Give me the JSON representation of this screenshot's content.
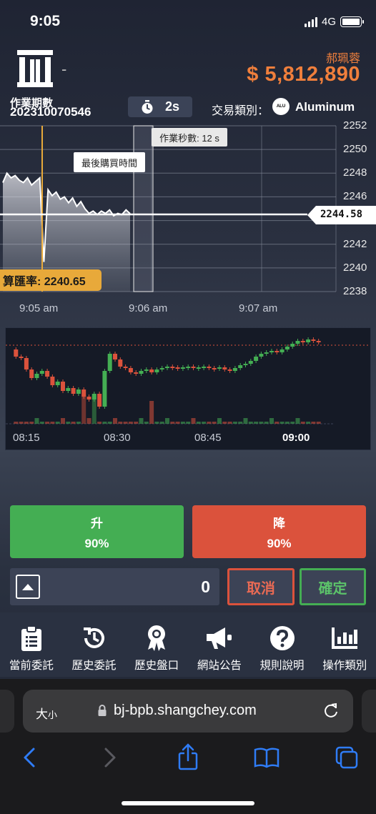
{
  "status_bar": {
    "time": "9:05",
    "network": "4G"
  },
  "header": {
    "logo_suffix": "-",
    "user_name": "郝珮蓉",
    "balance": "$ 5,812,890"
  },
  "info_bar": {
    "period_label": "作業期數",
    "period_value": "202310070546",
    "timer": "2s",
    "trade_type_label": "交易類別：",
    "trade_type_badge": "ALU",
    "trade_type_value": "Aluminum"
  },
  "main_chart": {
    "y_ticks": [
      "2252",
      "2250",
      "2248",
      "2246",
      "2244",
      "2242",
      "2240",
      "2238"
    ],
    "x_ticks": [
      "9:05 am",
      "9:06 am",
      "9:07 am"
    ],
    "tooltip_period": "作業秒數: 12 s",
    "tooltip_last_buy": "最後購買時間",
    "current_price": "2244.58",
    "rate_label": "算匯率: 2240.65"
  },
  "candle_chart": {
    "x_ticks": [
      "08:15",
      "08:30",
      "08:45",
      "09:00"
    ]
  },
  "chart_data": {
    "type": "line",
    "x": [
      "9:05 am",
      "9:06 am",
      "9:07 am"
    ],
    "y_ticks": [
      2252,
      2250,
      2248,
      2246,
      2244,
      2242,
      2240,
      2238
    ],
    "ylim": [
      2238,
      2252
    ],
    "current_price": 2244.58,
    "settlement_rate": 2240.65,
    "series": [
      {
        "values": [
          2247.2,
          2248.0,
          2247.6,
          2247.8,
          2247.4,
          2247.2,
          2247.6,
          2247.0,
          2247.3,
          2247.6,
          2240.5,
          2246.6,
          2246.1,
          2246.4,
          2245.8,
          2246.0,
          2245.5,
          2245.9,
          2245.2,
          2245.6,
          2245.0,
          2244.6,
          2244.8,
          2244.5,
          2244.8,
          2244.6,
          2244.9,
          2244.4,
          2244.6,
          2244.5,
          2244.9,
          2244.58
        ]
      }
    ]
  },
  "actions": {
    "up_label": "升",
    "up_payout": "90%",
    "down_label": "降",
    "down_payout": "90%",
    "amount": "0",
    "cancel_label": "取消",
    "confirm_label": "確定"
  },
  "bottom_nav": [
    {
      "label": "當前委託",
      "icon": "clipboard-icon"
    },
    {
      "label": "歷史委託",
      "icon": "history-icon"
    },
    {
      "label": "歷史盤口",
      "icon": "award-icon"
    },
    {
      "label": "網站公告",
      "icon": "megaphone-icon"
    },
    {
      "label": "規則說明",
      "icon": "help-icon"
    },
    {
      "label": "操作類別",
      "icon": "bar-chart-icon"
    }
  ],
  "browser": {
    "text_size_label": "大",
    "text_size_small": "小",
    "url": "bj-bpb.shangchey.com"
  },
  "colors": {
    "accent_orange": "#f07f3c",
    "up_green": "#44ae53",
    "down_red": "#db523c",
    "rate_yellow": "#e8a93a"
  }
}
